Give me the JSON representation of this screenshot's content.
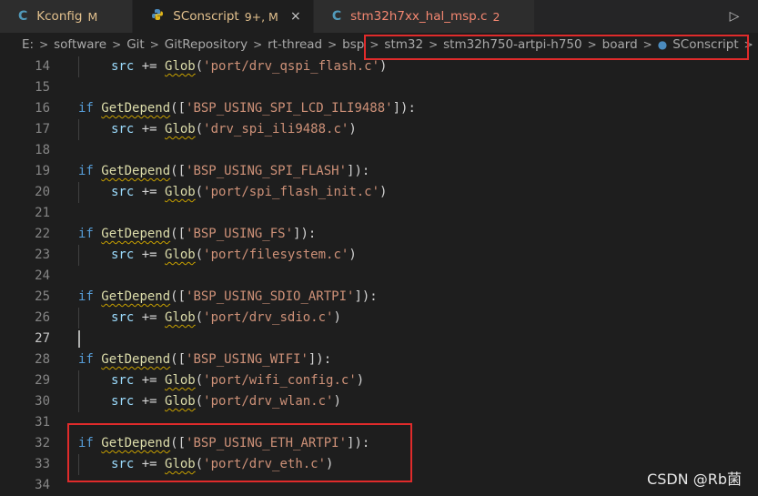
{
  "tabs": [
    {
      "icon": "C",
      "label": "Kconfig",
      "badge": "M",
      "status": "modified",
      "active": false
    },
    {
      "icon": "py",
      "label": "SConscript",
      "badge": "9+, M",
      "status": "modified",
      "active": true
    },
    {
      "icon": "C",
      "label": "stm32h7xx_hal_msp.c",
      "badge": "2",
      "status": "error",
      "active": false
    }
  ],
  "tab_close_glyph": "×",
  "run_glyph": "▷",
  "breadcrumb": [
    "E:",
    "software",
    "Git",
    "GitRepository",
    "rt-thread",
    "bsp",
    "stm32",
    "stm32h750-artpi-h750",
    "board",
    "SConscript"
  ],
  "breadcrumb_more": "...",
  "colors": {
    "keyword": "#569cd6",
    "function": "#dcdcaa",
    "string": "#ce9178",
    "variable": "#9cdcfe",
    "highlight_box": "#e02b2b"
  },
  "code_lines": [
    {
      "n": "14",
      "indent": 1,
      "text": "src += Glob('port/drv_qspi_flash.c')"
    },
    {
      "n": "15",
      "indent": 0,
      "text": ""
    },
    {
      "n": "16",
      "indent": 0,
      "text": "if GetDepend(['BSP_USING_SPI_LCD_ILI9488']):"
    },
    {
      "n": "17",
      "indent": 1,
      "text": "src += Glob('drv_spi_ili9488.c')"
    },
    {
      "n": "18",
      "indent": 0,
      "text": ""
    },
    {
      "n": "19",
      "indent": 0,
      "text": "if GetDepend(['BSP_USING_SPI_FLASH']):"
    },
    {
      "n": "20",
      "indent": 1,
      "text": "src += Glob('port/spi_flash_init.c')"
    },
    {
      "n": "21",
      "indent": 0,
      "text": ""
    },
    {
      "n": "22",
      "indent": 0,
      "text": "if GetDepend(['BSP_USING_FS']):"
    },
    {
      "n": "23",
      "indent": 1,
      "text": "src += Glob('port/filesystem.c')"
    },
    {
      "n": "24",
      "indent": 0,
      "text": ""
    },
    {
      "n": "25",
      "indent": 0,
      "text": "if GetDepend(['BSP_USING_SDIO_ARTPI']):"
    },
    {
      "n": "26",
      "indent": 1,
      "text": "src += Glob('port/drv_sdio.c')"
    },
    {
      "n": "27",
      "indent": 0,
      "text": "",
      "current": true
    },
    {
      "n": "28",
      "indent": 0,
      "text": "if GetDepend(['BSP_USING_WIFI']):"
    },
    {
      "n": "29",
      "indent": 1,
      "text": "src += Glob('port/wifi_config.c')"
    },
    {
      "n": "30",
      "indent": 1,
      "text": "src += Glob('port/drv_wlan.c')"
    },
    {
      "n": "31",
      "indent": 0,
      "text": ""
    },
    {
      "n": "32",
      "indent": 0,
      "text": "if GetDepend(['BSP_USING_ETH_ARTPI']):"
    },
    {
      "n": "33",
      "indent": 1,
      "text": "src += Glob('port/drv_eth.c')"
    },
    {
      "n": "34",
      "indent": 0,
      "text": ""
    }
  ],
  "watermark": "CSDN @Rb菌"
}
